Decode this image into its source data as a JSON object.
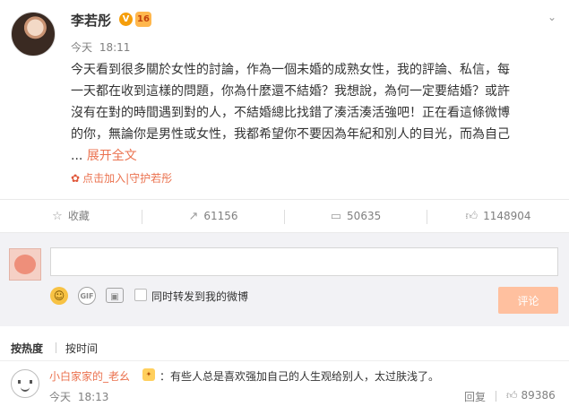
{
  "post": {
    "username": "李若彤",
    "verified_badge": "V",
    "level_badge": "16",
    "meta_day": "今天",
    "meta_time": "18:11",
    "text_lines": [
      "今天看到很多關於女性的討論，作為一個未婚的成熟女性，我的評論、私信，每",
      "一天都在收到這樣的問題，你為什麼還不結婚？我想說，為何一定要結婚？或許",
      "沒有在對的時間遇到對的人，不結婚總比找錯了湊活湊活強吧！正在看這條微博",
      "的你，無論你是男性或女性，我都希望你不要因為年紀和別人的目光，而為自己"
    ],
    "ellipsis": "...",
    "expand_label": "展开全文",
    "fan_join_label": "点击加入|守护若彤",
    "icons": {
      "menu": "chevron-down-icon",
      "fan": "flower-icon"
    }
  },
  "actions": {
    "favorite": {
      "icon": "star-icon",
      "label": "收藏"
    },
    "repost": {
      "icon": "share-icon",
      "label": "61156"
    },
    "comment": {
      "icon": "comment-icon",
      "label": "50635"
    },
    "like": {
      "icon": "thumbs-up-icon",
      "label": "1148904"
    }
  },
  "comment_box": {
    "input_value": "",
    "repost_label": "同时转发到我的微博",
    "submit_label": "评论"
  },
  "sort": {
    "hot": "按热度",
    "time": "按时间"
  },
  "comments": [
    {
      "user": "小白家家的_老幺",
      "text": "：有些人总是喜欢强加自己的人生观给别人，太过肤浅了。",
      "day": "今天",
      "time": "18:13",
      "reply_label": "回复",
      "likes": "89386"
    }
  ],
  "colors": {
    "accent": "#eb7350",
    "submit_disabled": "#ffc09f",
    "comment_bg": "#f2f2f5"
  }
}
